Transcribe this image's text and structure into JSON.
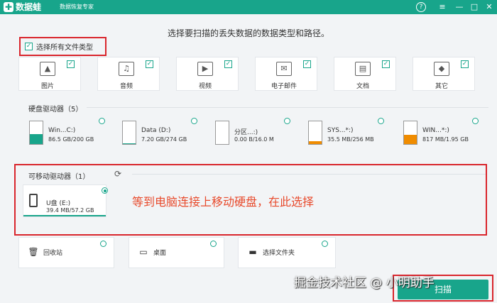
{
  "app": {
    "logo_text": "数据蛙",
    "tagline": "数据恢复专家",
    "brand_color": "#18a58b"
  },
  "window_controls": {
    "help": "?",
    "menu": "≡",
    "minimize": "—",
    "maximize": "□",
    "close": "✕"
  },
  "instruction": "选择要扫描的丢失数据的数据类型和路径。",
  "select_all": {
    "label": "选择所有文件类型",
    "checked": true
  },
  "file_types": [
    {
      "label": "图片",
      "icon": "image-icon",
      "glyph": "▲"
    },
    {
      "label": "音频",
      "icon": "music-icon",
      "glyph": "♫"
    },
    {
      "label": "视频",
      "icon": "video-icon",
      "glyph": "▶"
    },
    {
      "label": "电子邮件",
      "icon": "email-icon",
      "glyph": "✉"
    },
    {
      "label": "文档",
      "icon": "document-icon",
      "glyph": "▤"
    },
    {
      "label": "其它",
      "icon": "other-icon",
      "glyph": "◆"
    }
  ],
  "hard_drives": {
    "label": "硬盘驱动器（5）",
    "items": [
      {
        "name": "Win...C:)",
        "size": "86.5 GB/200 GB",
        "used": 0.43,
        "color": "#18a58b"
      },
      {
        "name": "Data (D:)",
        "size": "7.20 GB/274 GB",
        "used": 0.03,
        "color": "#18a58b"
      },
      {
        "name": "分区...:)",
        "size": "0.00  B/16.0 M",
        "used": 0.0,
        "color": "#18a58b"
      },
      {
        "name": "SYS...*:)",
        "size": "35.5 MB/256 MB",
        "used": 0.14,
        "color": "#f08c00"
      },
      {
        "name": "WIN...*:)",
        "size": "817 MB/1.95 GB",
        "used": 0.42,
        "color": "#f08c00"
      }
    ]
  },
  "removable": {
    "label": "可移动驱动器（1）",
    "refresh_glyph": "⟳",
    "items": [
      {
        "name": "U盘 (E:)",
        "size": "39.4 MB/57.2 GB",
        "selected": true
      }
    ]
  },
  "annotation": "等到电脑连接上移动硬盘，在此选择",
  "bottom": [
    {
      "label": "回收站",
      "glyph": "🗑"
    },
    {
      "label": "桌面",
      "glyph": "▭"
    },
    {
      "label": "选择文件夹",
      "glyph": "▬"
    }
  ],
  "watermark": "掘金技术社区 @ 小明助手",
  "scan_button": "扫描"
}
